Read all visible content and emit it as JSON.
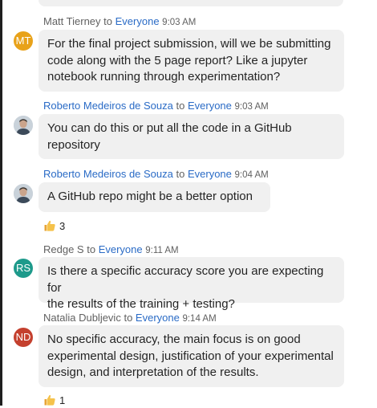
{
  "colors": {
    "accent_link": "#2a6bc6",
    "bubble": "#f0f0f0"
  },
  "messages": [
    {
      "sender": "Matt Tierney",
      "to_word": "to",
      "target": "Everyone",
      "time": "9:03 AM",
      "avatar": {
        "initials": "MT",
        "color": "#e8a21a"
      },
      "lines": [
        "For the final project submission, will we be submitting",
        "code along with the 5 page report? Like a jupyter",
        "notebook running through experimentation?"
      ]
    },
    {
      "sender": "Roberto Medeiros de Souza",
      "to_word": "to",
      "target": "Everyone",
      "time": "9:03 AM",
      "avatar": {
        "type": "photo"
      },
      "lines": [
        "You can do this or put all the code in a GitHub",
        "repository"
      ]
    },
    {
      "sender": "Roberto Medeiros de Souza",
      "to_word": "to",
      "target": "Everyone",
      "time": "9:04 AM",
      "avatar": {
        "type": "photo"
      },
      "lines": [
        "A GitHub repo might be a better option"
      ],
      "reaction": {
        "icon": "thumbs-up-icon",
        "count": "3"
      }
    },
    {
      "sender": "Redge S",
      "to_word": "to",
      "target": "Everyone",
      "time": "9:11 AM",
      "avatar": {
        "initials": "RS",
        "color": "#1e9a8b"
      },
      "lines": [
        "Is there a specific accuracy score you are expecting for",
        "the results of the training + testing?"
      ]
    },
    {
      "sender": "Natalia Dubljevic",
      "to_word": "to",
      "target": "Everyone",
      "time": "9:14 AM",
      "avatar": {
        "initials": "ND",
        "color": "#c4402e"
      },
      "lines": [
        "No specific accuracy, the main focus is on good",
        "experimental design, justification of your experimental",
        "design, and interpretation of the results."
      ],
      "reaction": {
        "icon": "thumbs-up-icon",
        "count": "1"
      }
    }
  ]
}
